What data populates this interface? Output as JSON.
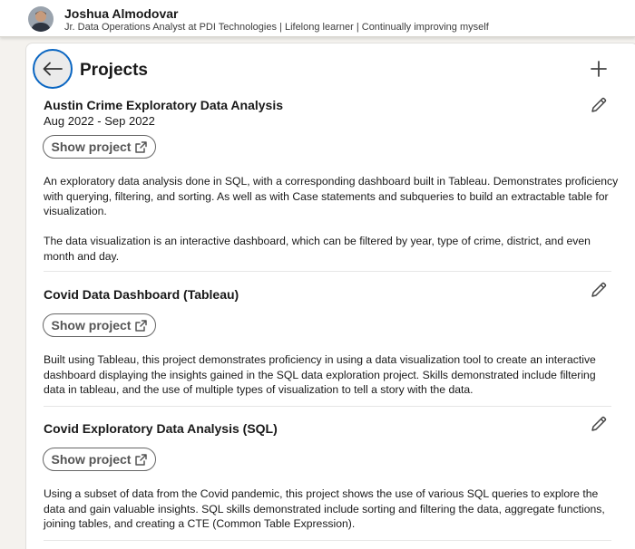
{
  "profile": {
    "name": "Joshua Almodovar",
    "headline": "Jr. Data Operations Analyst at PDI Technologies | Lifelong learner | Continually improving myself"
  },
  "section": {
    "title": "Projects"
  },
  "projects": [
    {
      "title": "Austin Crime Exploratory Data Analysis",
      "date": "Aug 2022 - Sep 2022",
      "button_label": "Show project",
      "desc_lines": [
        "An exploratory data analysis done in SQL, with a corresponding dashboard built in Tableau. Demonstrates proficiency",
        "with querying, filtering, and sorting. As well as with Case statements and subqueries to build an extractable table for",
        "visualization.",
        "",
        "The data visualization is an interactive dashboard, which can be filtered by year, type of crime, district, and even",
        "month and day."
      ]
    },
    {
      "title": "Covid Data Dashboard (Tableau)",
      "button_label": "Show project",
      "desc_lines": [
        "Built using Tableau, this project demonstrates proficiency in using a data visualization tool to create an interactive",
        "dashboard displaying the insights gained in the SQL data exploration project. Skills demonstrated include filtering",
        "data in tableau, and the use of multiple types of visualization to tell a story with the data."
      ]
    },
    {
      "title": "Covid Exploratory Data Analysis (SQL)",
      "button_label": "Show project",
      "desc_lines": [
        "Using a subset of data from the Covid pandemic, this project shows the use of various SQL queries to explore the",
        "data and gain valuable insights. SQL skills demonstrated include sorting and filtering the data, aggregate functions,",
        "joining tables, and creating a CTE (Common Table Expression)."
      ]
    }
  ],
  "icons": {
    "back": "arrow-left-icon",
    "add": "plus-icon",
    "edit": "pencil-icon",
    "external": "external-link-icon"
  },
  "colors": {
    "accent": "#0a66c2",
    "background": "#f4f2ee",
    "card": "#ffffff",
    "text": "#191919"
  }
}
